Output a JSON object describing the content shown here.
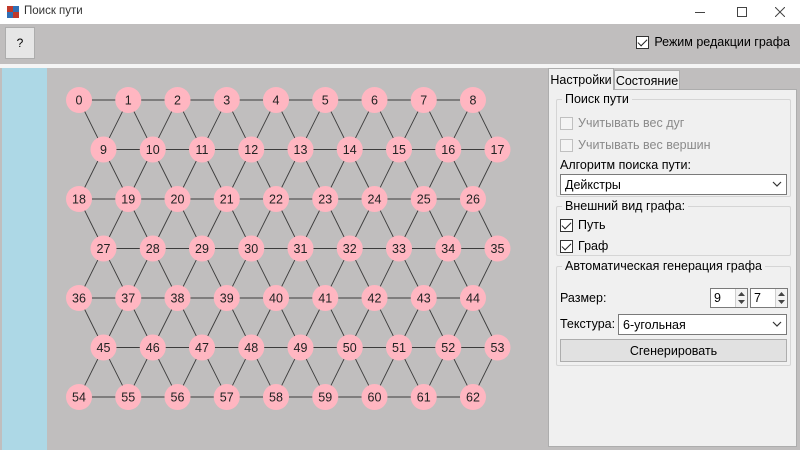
{
  "window": {
    "title": "Поиск пути",
    "controls": {
      "minimize_icon": "minimize-icon",
      "maximize_icon": "maximize-icon",
      "close_icon": "close-icon"
    }
  },
  "toolbar": {
    "help_label": "?",
    "edit_mode_label": "Режим редакции графа",
    "edit_mode_checked": true
  },
  "tabs": [
    {
      "label": "Настройки",
      "active": true
    },
    {
      "label": "Состояние",
      "active": false
    }
  ],
  "settings": {
    "path_search": {
      "title": "Поиск пути",
      "consider_arc_weight": {
        "label": "Учитывать вес дуг",
        "checked": false,
        "enabled": false
      },
      "consider_vertex_weight": {
        "label": "Учитывать вес вершин",
        "checked": false,
        "enabled": false
      },
      "algorithm_label": "Алгоритм поиска пути:",
      "algorithm_value": "Дейкстры"
    },
    "appearance": {
      "title": "Внешний вид графа:",
      "path": {
        "label": "Путь",
        "checked": true
      },
      "graph": {
        "label": "Граф",
        "checked": true
      }
    },
    "generation": {
      "title": "Автоматическая генерация графа",
      "size_label": "Размер:",
      "size_width": "9",
      "size_height": "7",
      "texture_label": "Текстура:",
      "texture_value": "6-угольная",
      "generate_label": "Сгенерировать"
    }
  },
  "graph": {
    "columns": 9,
    "rows": 7,
    "node_color": "#ffb6c1",
    "edge_color": "#3c3c3c",
    "node_labels": [
      "0",
      "1",
      "2",
      "3",
      "4",
      "5",
      "6",
      "7",
      "8",
      "9",
      "10",
      "11",
      "12",
      "13",
      "14",
      "15",
      "16",
      "17",
      "18",
      "19",
      "20",
      "21",
      "22",
      "23",
      "24",
      "25",
      "26",
      "27",
      "28",
      "29",
      "30",
      "31",
      "32",
      "33",
      "34",
      "35",
      "36",
      "37",
      "38",
      "39",
      "40",
      "41",
      "42",
      "43",
      "44",
      "45",
      "46",
      "47",
      "48",
      "49",
      "50",
      "51",
      "52",
      "53",
      "54",
      "55",
      "56",
      "57",
      "58",
      "59",
      "60",
      "61",
      "62"
    ]
  },
  "colors": {
    "background": "#c0bebe",
    "left_strip": "#add8e6",
    "panel": "#f0f0f0"
  }
}
